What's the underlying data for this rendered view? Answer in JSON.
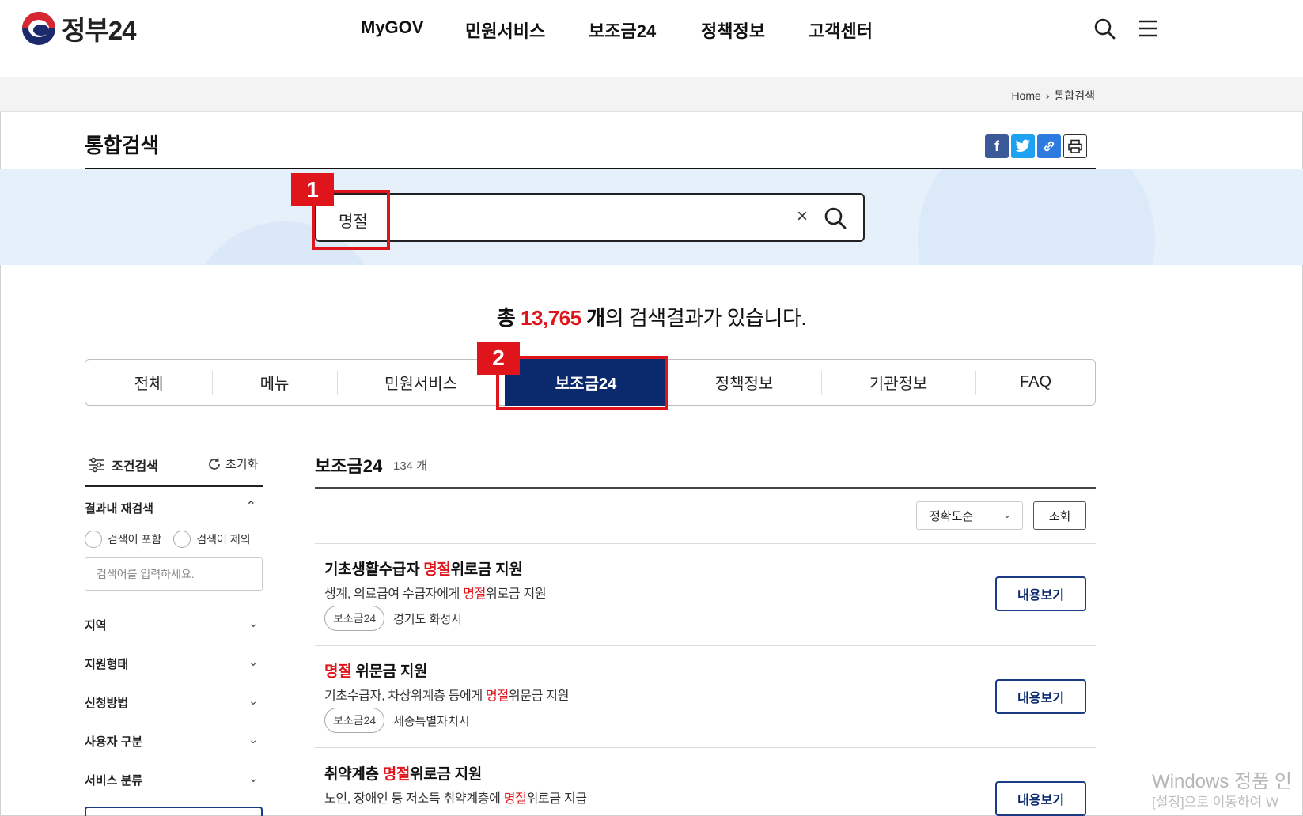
{
  "brand": {
    "name": "정부24"
  },
  "nav": {
    "items": [
      "MyGOV",
      "민원서비스",
      "보조금24",
      "정책정보",
      "고객센터"
    ]
  },
  "header_icons": {
    "search": "search-icon",
    "menu": "hamburger-menu-icon"
  },
  "breadcrumb": {
    "home": "Home",
    "current": "통합검색"
  },
  "page": {
    "title": "통합검색"
  },
  "share_icons": [
    "facebook-icon",
    "twitter-icon",
    "link-icon",
    "print-icon"
  ],
  "search": {
    "value": "명절",
    "clear": "×"
  },
  "callouts": {
    "one": "1",
    "two": "2"
  },
  "results": {
    "prefix": "총 ",
    "count": "13,765",
    "unit": " 개",
    "suffix": "의 검색결과가 있습니다."
  },
  "tabs": [
    "전체",
    "메뉴",
    "민원서비스",
    "보조금24",
    "정책정보",
    "기관정보",
    "FAQ"
  ],
  "active_tab": "보조금24",
  "filter": {
    "title": "조건검색",
    "reset": "초기화",
    "research_title": "결과내 재검색",
    "include_label": "검색어 포함",
    "exclude_label": "검색어 제외",
    "input_placeholder": "검색어를 입력하세요.",
    "sections": [
      "지역",
      "지원형태",
      "신청방법",
      "사용자 구분",
      "서비스 분류"
    ]
  },
  "section": {
    "title": "보조금24",
    "count": "134 개"
  },
  "sort": {
    "selected": "정확도순",
    "button": "조회"
  },
  "cards": [
    {
      "title_pre": "기초생활수급자 ",
      "title_hi": "명절",
      "title_post": "위로금 지원",
      "desc_pre": "생계, 의료급여 수급자에게 ",
      "desc_hi": "명절",
      "desc_post": "위로금 지원",
      "tag": "보조금24",
      "region": "경기도 화성시",
      "button": "내용보기"
    },
    {
      "title_pre": "",
      "title_hi": "명절",
      "title_post": " 위문금 지원",
      "desc_pre": "기초수급자, 차상위계층 등에게 ",
      "desc_hi": "명절",
      "desc_post": "위문금 지원",
      "tag": "보조금24",
      "region": "세종특별자치시",
      "button": "내용보기"
    },
    {
      "title_pre": "취약계층 ",
      "title_hi": "명절",
      "title_post": "위로금 지원",
      "desc_pre": "노인, 장애인 등 저소득 취약계층에 ",
      "desc_hi": "명절",
      "desc_post": "위로금 지급",
      "tag": "",
      "region": "",
      "button": "내용보기"
    }
  ],
  "watermark": {
    "line1": "Windows 정품 인",
    "line2": "[설정]으로 이동하여 W"
  },
  "colors": {
    "accent": "#0b2a6e",
    "highlight": "#e0151c",
    "banner": "#e6f0fb"
  }
}
